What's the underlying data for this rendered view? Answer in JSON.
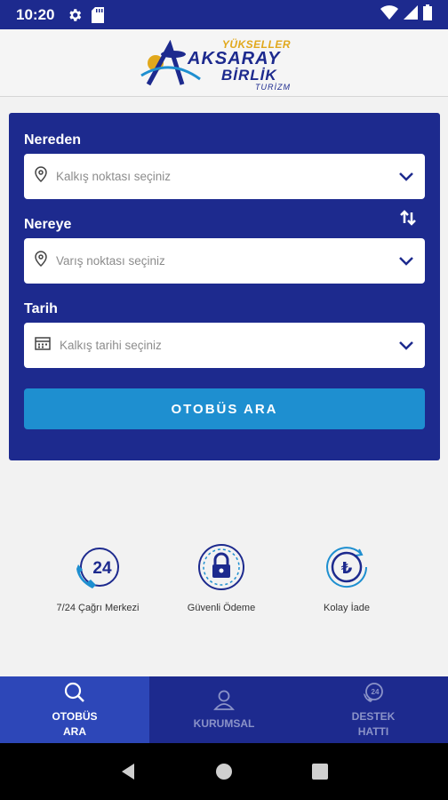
{
  "status_bar": {
    "time": "10:20",
    "icons_left": [
      "settings-icon",
      "sd-card-icon"
    ],
    "icons_right": [
      "wifi-icon",
      "signal-icon",
      "battery-icon"
    ]
  },
  "header": {
    "logo_line1": "YÜKSELLER",
    "logo_line2": "AKSARAY",
    "logo_line3": "BİRLİK",
    "logo_line4": "TURİZM"
  },
  "search_form": {
    "from": {
      "label": "Nereden",
      "placeholder": "Kalkış noktası seçiniz",
      "icon": "location-pin-icon"
    },
    "to": {
      "label": "Nereye",
      "placeholder": "Varış noktası seçiniz",
      "icon": "location-pin-icon"
    },
    "date": {
      "label": "Tarih",
      "placeholder": "Kalkış tarihi seçiniz",
      "icon": "calendar-icon"
    },
    "swap_icon": "swap-icon",
    "submit_label": "OTOBÜS ARA"
  },
  "features": [
    {
      "label": "7/24 Çağrı Merkezi",
      "icon": "phone-24-icon",
      "badge": "24"
    },
    {
      "label": "Güvenli Ödeme",
      "icon": "padlock-icon"
    },
    {
      "label": "Kolay İade",
      "icon": "refund-lira-icon"
    }
  ],
  "bottom_nav": [
    {
      "label": "OTOBÜS ARA",
      "icon": "search-icon",
      "active": true
    },
    {
      "label": "KURUMSAL",
      "icon": "user-icon",
      "active": false
    },
    {
      "label": "DESTEK HATTI",
      "icon": "support-24-icon",
      "active": false
    }
  ],
  "colors": {
    "primary": "#1d2a8e",
    "accent": "#1e8fd0",
    "nav_active": "#2d47b8",
    "gold": "#e1a81c"
  }
}
